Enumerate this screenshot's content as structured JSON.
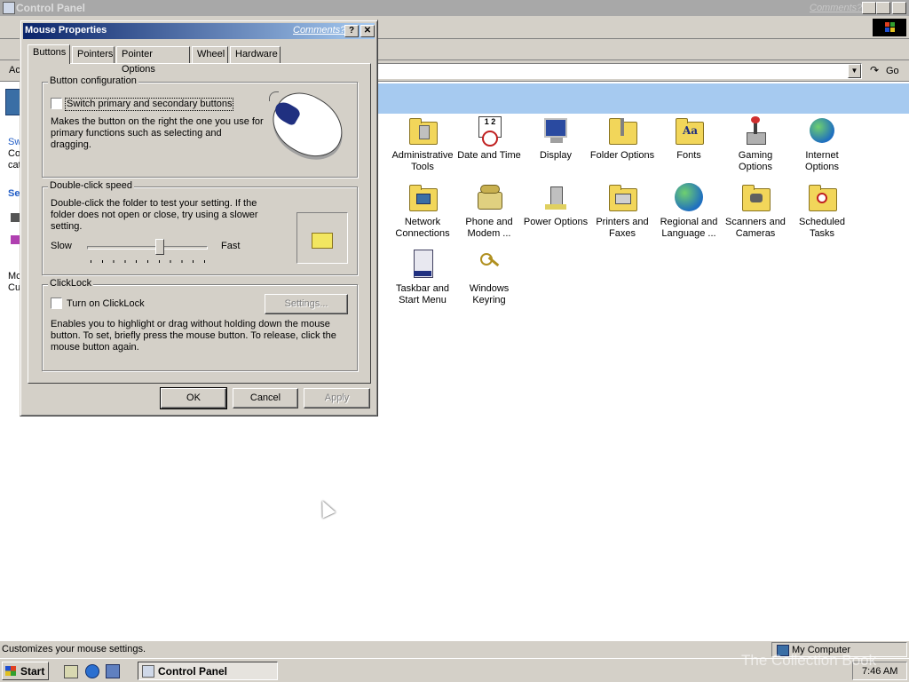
{
  "control_panel": {
    "title": "Control Panel",
    "comments_link": "Comments?",
    "address_label": "Ac",
    "go_label": "Go",
    "left_pane": {
      "line1": "Sw",
      "line2": "Co",
      "line3": "cat",
      "see_also": "Se",
      "bottom1": "Mc",
      "bottom2": "Cu"
    },
    "items": [
      {
        "label": "Administrative Tools",
        "icon": "admin-tools-icon"
      },
      {
        "label": "Date and Time",
        "icon": "date-time-icon"
      },
      {
        "label": "Display",
        "icon": "display-icon"
      },
      {
        "label": "Folder Options",
        "icon": "folder-options-icon"
      },
      {
        "label": "Fonts",
        "icon": "fonts-icon"
      },
      {
        "label": "Gaming Options",
        "icon": "gaming-options-icon"
      },
      {
        "label": "Internet Options",
        "icon": "internet-options-icon"
      },
      {
        "label": "Network Connections",
        "icon": "network-connections-icon"
      },
      {
        "label": "Phone and Modem ...",
        "icon": "phone-modem-icon"
      },
      {
        "label": "Power Options",
        "icon": "power-options-icon"
      },
      {
        "label": "Printers and Faxes",
        "icon": "printers-faxes-icon"
      },
      {
        "label": "Regional and Language ...",
        "icon": "regional-language-icon"
      },
      {
        "label": "Scanners and Cameras",
        "icon": "scanners-cameras-icon"
      },
      {
        "label": "Scheduled Tasks",
        "icon": "scheduled-tasks-icon"
      },
      {
        "label": "Taskbar and Start Menu",
        "icon": "taskbar-start-icon"
      },
      {
        "label": "Windows Keyring",
        "icon": "keyring-icon"
      }
    ]
  },
  "dialog": {
    "title": "Mouse Properties",
    "comments_link": "Comments?",
    "help_btn": "?",
    "close_btn": "✕",
    "tabs": [
      "Buttons",
      "Pointers",
      "Pointer Options",
      "Wheel",
      "Hardware"
    ],
    "active_tab": "Buttons",
    "button_config": {
      "legend": "Button configuration",
      "switch_label": "Switch primary and secondary buttons",
      "switch_checked": false,
      "description": "Makes the button on the right the one you use for primary functions such as selecting and dragging."
    },
    "double_click": {
      "legend": "Double-click speed",
      "description": "Double-click the folder to test your setting. If the folder does not open or close, try using a slower setting.",
      "slow_label": "Slow",
      "fast_label": "Fast",
      "slider_position": 0.6
    },
    "clicklock": {
      "legend": "ClickLock",
      "checkbox_label": "Turn on ClickLock",
      "checked": false,
      "settings_button": "Settings...",
      "description": "Enables you to highlight or drag without holding down the mouse button. To set, briefly press the mouse button. To release, click the mouse button again."
    },
    "ok_button": "OK",
    "cancel_button": "Cancel",
    "apply_button": "Apply"
  },
  "statusbar": {
    "message": "Customizes your mouse settings.",
    "zone": "My Computer"
  },
  "taskbar": {
    "start_label": "Start",
    "task_label": "Control Panel",
    "clock": "7:46 AM",
    "watermark": "The Collection Book"
  },
  "colors": {
    "dialog_title_start": "#0a246a",
    "dialog_title_end": "#a6caf0",
    "face": "#d4d0c8",
    "banner": "#a6caf0"
  }
}
